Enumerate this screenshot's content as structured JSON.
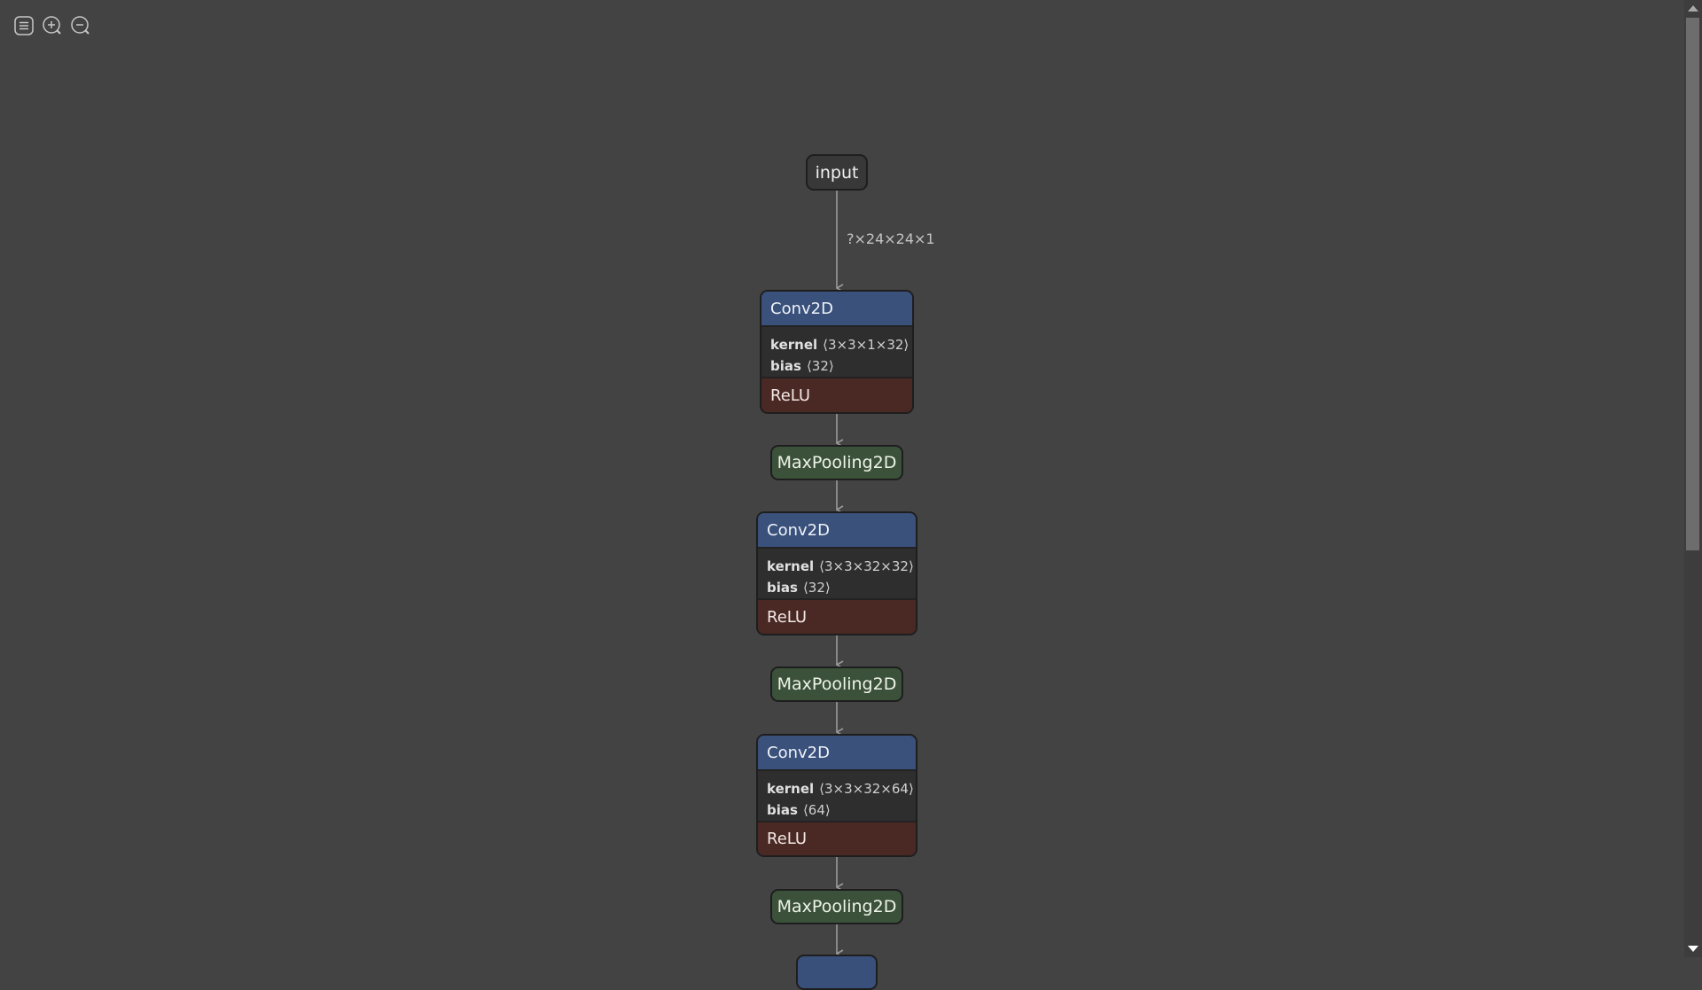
{
  "toolbar": {
    "buttons": [
      {
        "name": "menu",
        "icon": "hamburger-icon"
      },
      {
        "name": "zoom-in",
        "icon": "zoom-in-icon"
      },
      {
        "name": "zoom-out",
        "icon": "zoom-out-icon"
      }
    ]
  },
  "graph": {
    "input": {
      "label": "input",
      "output_shape": "?×24×24×1"
    },
    "layers": [
      {
        "type": "Conv2D",
        "attrs": [
          {
            "name": "kernel",
            "value": "⟨3×3×1×32⟩"
          },
          {
            "name": "bias",
            "value": "⟨32⟩"
          }
        ],
        "activation": "ReLU"
      },
      {
        "type": "MaxPooling2D"
      },
      {
        "type": "Conv2D",
        "attrs": [
          {
            "name": "kernel",
            "value": "⟨3×3×32×32⟩"
          },
          {
            "name": "bias",
            "value": "⟨32⟩"
          }
        ],
        "activation": "ReLU"
      },
      {
        "type": "MaxPooling2D"
      },
      {
        "type": "Conv2D",
        "attrs": [
          {
            "name": "kernel",
            "value": "⟨3×3×32×64⟩"
          },
          {
            "name": "bias",
            "value": "⟨64⟩"
          }
        ],
        "activation": "ReLU"
      },
      {
        "type": "MaxPooling2D"
      }
    ]
  },
  "colors": {
    "background": "#434343",
    "layer_header": "#3a517b",
    "activation": "#4a2823",
    "pooling": "#3b5139",
    "attributes": "#2e2e2e"
  }
}
